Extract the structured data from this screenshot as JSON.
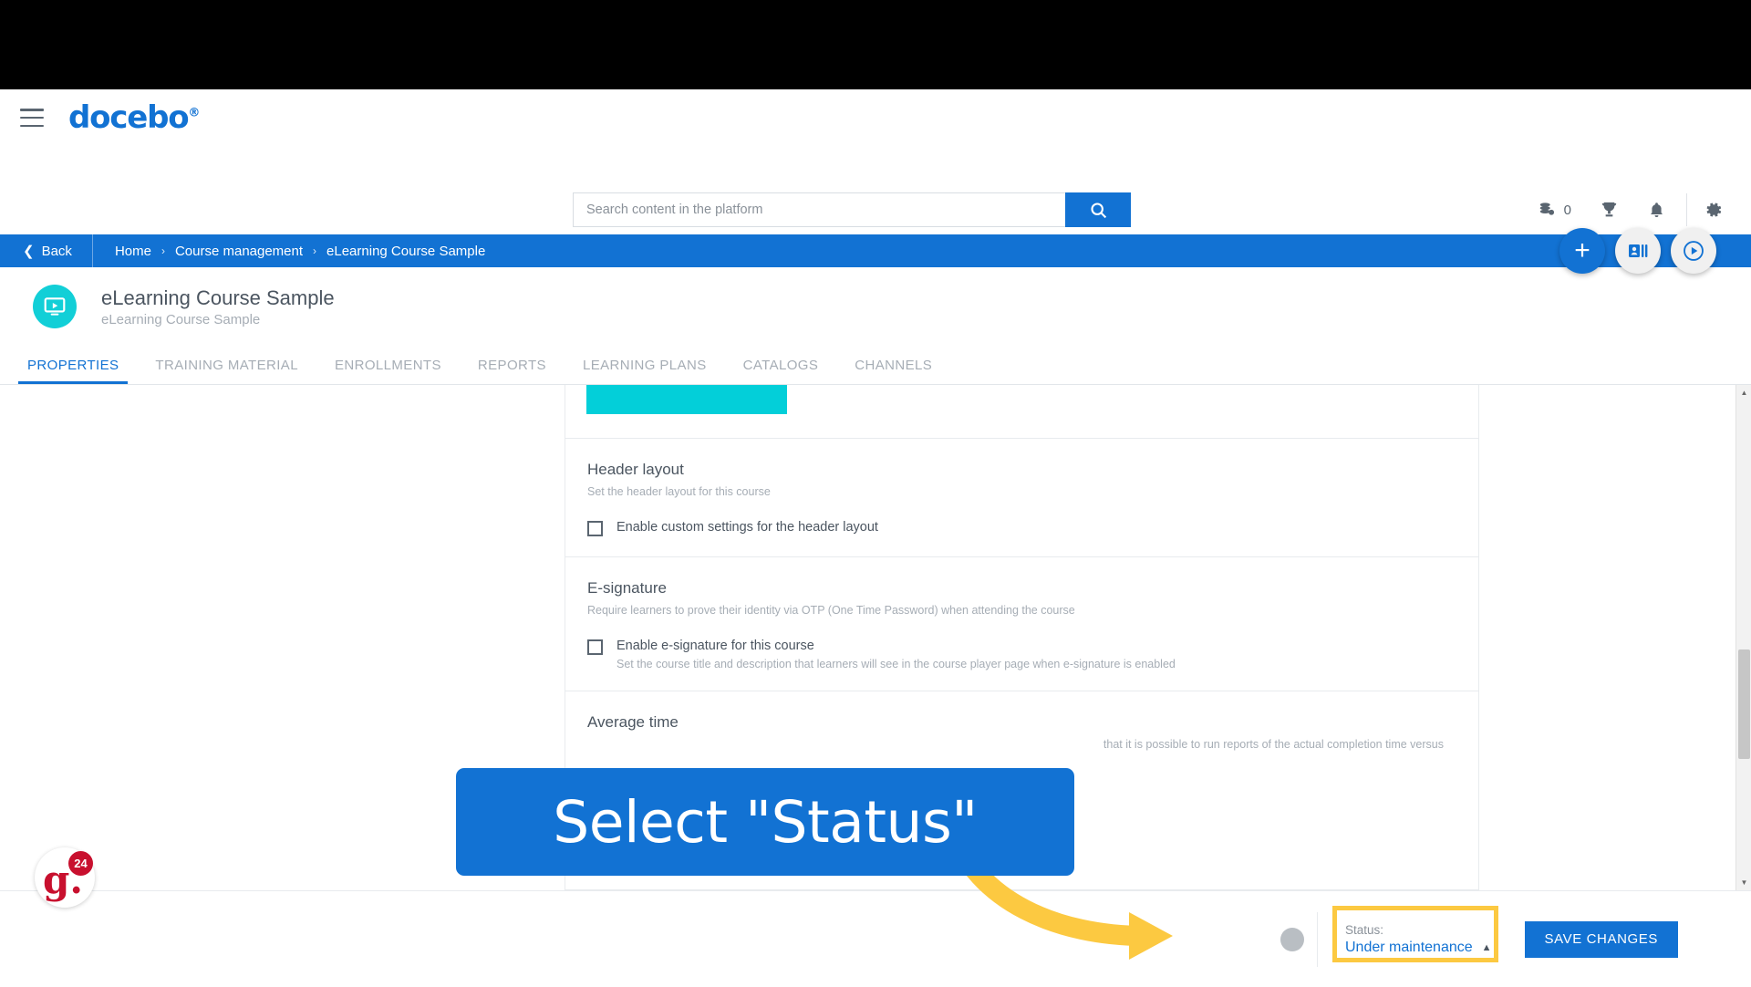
{
  "topbar": {
    "logo_text": "docebo",
    "logo_registered": "®",
    "menu_icon": "hamburger-menu-icon",
    "search": {
      "placeholder": "Search content in the platform",
      "value": "",
      "button_icon": "search-icon"
    },
    "icons": {
      "coins_label": "0",
      "coins_icon": "coins-icon",
      "trophy_icon": "trophy-icon",
      "bell_icon": "bell-icon",
      "gear_icon": "gear-icon"
    }
  },
  "breadcrumb": {
    "back_label": "Back",
    "back_icon": "chevron-left-icon",
    "items": [
      "Home",
      "Course management",
      "eLearning Course Sample"
    ],
    "separator": "›"
  },
  "fabs": [
    {
      "name": "add-button",
      "label": "+",
      "icon": "plus-icon"
    },
    {
      "name": "enrollments-button",
      "label": "",
      "icon": "id-card-icon"
    },
    {
      "name": "play-course-button",
      "label": "",
      "icon": "play-circle-icon"
    }
  ],
  "course": {
    "icon": "course-monitor-play-icon",
    "title": "eLearning Course Sample",
    "subtitle": "eLearning Course Sample"
  },
  "tabs": [
    {
      "label": "PROPERTIES",
      "active": true
    },
    {
      "label": "TRAINING MATERIAL",
      "active": false
    },
    {
      "label": "ENROLLMENTS",
      "active": false
    },
    {
      "label": "REPORTS",
      "active": false
    },
    {
      "label": "LEARNING PLANS",
      "active": false
    },
    {
      "label": "CATALOGS",
      "active": false
    },
    {
      "label": "CHANNELS",
      "active": false
    }
  ],
  "sections": {
    "header_layout": {
      "title": "Header layout",
      "subtitle": "Set the header layout for this course",
      "checkbox_label": "Enable custom settings for the header layout",
      "checked": false
    },
    "esignature": {
      "title": "E-signature",
      "subtitle": "Require learners to prove their identity via OTP (One Time Password) when attending the course",
      "checkbox_label": "Enable e-signature for this course",
      "checkbox_help": "Set the course title and description that learners will see in the course player page when e-signature is enabled",
      "checked": false
    },
    "average_time": {
      "title": "Average time",
      "subtitle": "that it is possible to run reports of the actual completion time versus"
    }
  },
  "bottom": {
    "status_label": "Status:",
    "status_value": "Under maintenance",
    "caret_icon": "caret-up-icon",
    "save_label": "SAVE CHANGES"
  },
  "callout": {
    "text": "Select \"Status\"",
    "color": "#1272d3",
    "arrow_color": "#fcc941",
    "highlight_color": "#fcc941"
  },
  "badge": {
    "letter": "g.",
    "count": "24"
  }
}
